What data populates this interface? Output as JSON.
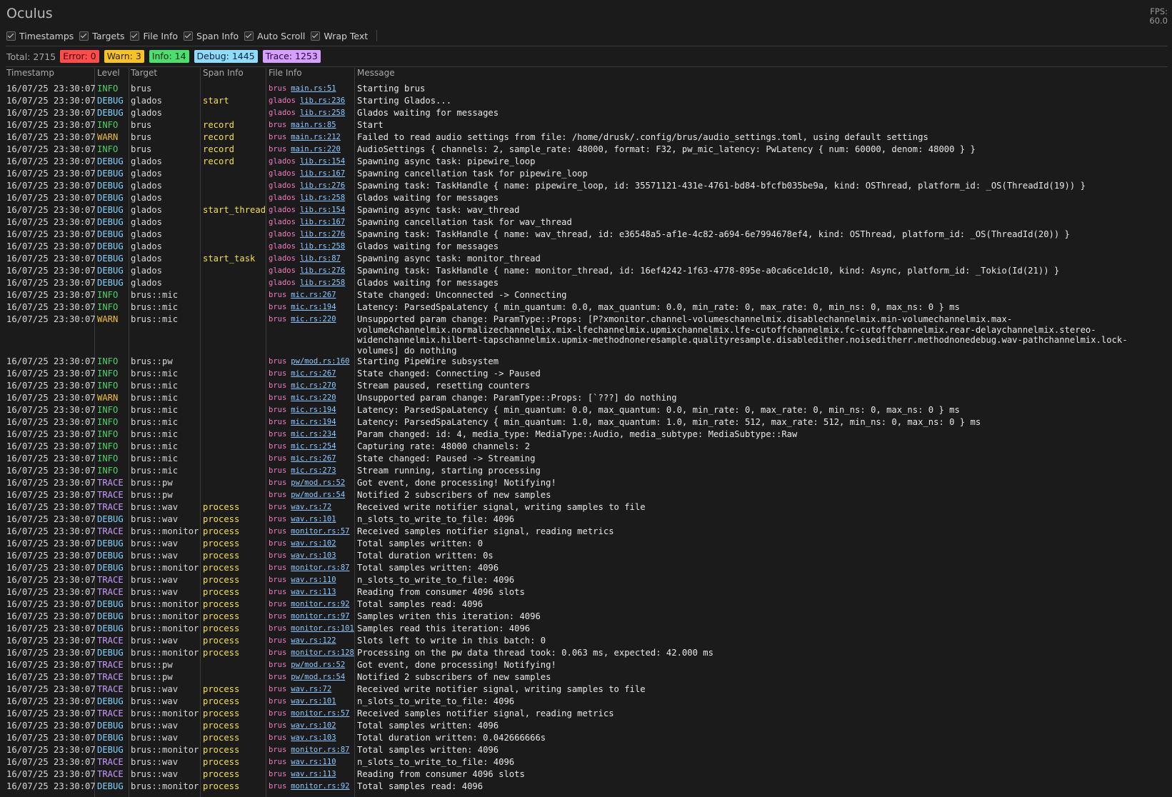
{
  "app": {
    "title": "Oculus",
    "fps_label": "FPS:",
    "fps_value": "60.0"
  },
  "toolbar": [
    {
      "label": "Timestamps",
      "checked": true
    },
    {
      "label": "Targets",
      "checked": true
    },
    {
      "label": "File Info",
      "checked": true
    },
    {
      "label": "Span Info",
      "checked": true
    },
    {
      "label": "Auto Scroll",
      "checked": true
    },
    {
      "label": "Wrap Text",
      "checked": true
    }
  ],
  "summary": {
    "total": "Total: 2715",
    "error": "Error: 0",
    "warn": "Warn: 3",
    "info": "Info: 14",
    "debug": "Debug: 1445",
    "trace": "Trace: 1253"
  },
  "columns": [
    "Timestamp",
    "Level",
    "Target",
    "Span Info",
    "File Info",
    "Message"
  ],
  "colors": {
    "error": "#ff4d4d",
    "warn": "#f7c325",
    "info": "#4cde6f",
    "debug": "#8fdcff",
    "trace": "#d5a0ff",
    "span": "#f1e04a",
    "crate": "#f07bbf",
    "file": "#8cc8ff"
  },
  "rows": [
    {
      "ts": "16/07/25 23:30:07",
      "level": "INFO",
      "target": "brus",
      "span": "",
      "crate": "brus",
      "file": "main.rs:51",
      "msg": "Starting brus"
    },
    {
      "ts": "16/07/25 23:30:07",
      "level": "DEBUG",
      "target": "glados",
      "span": "start",
      "crate": "glados",
      "file": "lib.rs:236",
      "msg": "Starting Glados..."
    },
    {
      "ts": "16/07/25 23:30:07",
      "level": "DEBUG",
      "target": "glados",
      "span": "",
      "crate": "glados",
      "file": "lib.rs:258",
      "msg": "Glados waiting for messages"
    },
    {
      "ts": "16/07/25 23:30:07",
      "level": "INFO",
      "target": "brus",
      "span": "record",
      "crate": "brus",
      "file": "main.rs:85",
      "msg": "Start"
    },
    {
      "ts": "16/07/25 23:30:07",
      "level": "WARN",
      "target": "brus",
      "span": "record",
      "crate": "brus",
      "file": "main.rs:212",
      "msg": "Failed to read audio settings from file: /home/drusk/.config/brus/audio_settings.toml, using default settings"
    },
    {
      "ts": "16/07/25 23:30:07",
      "level": "INFO",
      "target": "brus",
      "span": "record",
      "crate": "brus",
      "file": "main.rs:220",
      "msg": "AudioSettings { channels: 2, sample_rate: 48000, format: F32, pw_mic_latency: PwLatency { num: 60000, denom: 48000 } }"
    },
    {
      "ts": "16/07/25 23:30:07",
      "level": "DEBUG",
      "target": "glados",
      "span": "record",
      "crate": "glados",
      "file": "lib.rs:154",
      "msg": "Spawning async task: pipewire_loop"
    },
    {
      "ts": "16/07/25 23:30:07",
      "level": "DEBUG",
      "target": "glados",
      "span": "",
      "crate": "glados",
      "file": "lib.rs:167",
      "msg": "Spawning cancellation task for pipewire_loop"
    },
    {
      "ts": "16/07/25 23:30:07",
      "level": "DEBUG",
      "target": "glados",
      "span": "",
      "crate": "glados",
      "file": "lib.rs:276",
      "msg": "Spawning task: TaskHandle { name: pipewire_loop, id: 35571121-431e-4761-bd84-bfcfb035be9a, kind: OSThread, platform_id: _OS(ThreadId(19)) }"
    },
    {
      "ts": "16/07/25 23:30:07",
      "level": "DEBUG",
      "target": "glados",
      "span": "",
      "crate": "glados",
      "file": "lib.rs:258",
      "msg": "Glados waiting for messages"
    },
    {
      "ts": "16/07/25 23:30:07",
      "level": "DEBUG",
      "target": "glados",
      "span": "start_thread",
      "crate": "glados",
      "file": "lib.rs:154",
      "msg": "Spawning async task: wav_thread"
    },
    {
      "ts": "16/07/25 23:30:07",
      "level": "DEBUG",
      "target": "glados",
      "span": "",
      "crate": "glados",
      "file": "lib.rs:167",
      "msg": "Spawning cancellation task for wav_thread"
    },
    {
      "ts": "16/07/25 23:30:07",
      "level": "DEBUG",
      "target": "glados",
      "span": "",
      "crate": "glados",
      "file": "lib.rs:276",
      "msg": "Spawning task: TaskHandle { name: wav_thread, id: e36548a5-af1e-4c82-a694-6e7994678ef4, kind: OSThread, platform_id: _OS(ThreadId(20)) }"
    },
    {
      "ts": "16/07/25 23:30:07",
      "level": "DEBUG",
      "target": "glados",
      "span": "",
      "crate": "glados",
      "file": "lib.rs:258",
      "msg": "Glados waiting for messages"
    },
    {
      "ts": "16/07/25 23:30:07",
      "level": "DEBUG",
      "target": "glados",
      "span": "start_task",
      "crate": "glados",
      "file": "lib.rs:87",
      "msg": "Spawning async task: monitor_thread"
    },
    {
      "ts": "16/07/25 23:30:07",
      "level": "DEBUG",
      "target": "glados",
      "span": "",
      "crate": "glados",
      "file": "lib.rs:276",
      "msg": "Spawning task: TaskHandle { name: monitor_thread, id: 16ef4242-1f63-4778-895e-a0ca6ce1dc10, kind: Async, platform_id: _Tokio(Id(21)) }"
    },
    {
      "ts": "16/07/25 23:30:07",
      "level": "DEBUG",
      "target": "glados",
      "span": "",
      "crate": "glados",
      "file": "lib.rs:258",
      "msg": "Glados waiting for messages"
    },
    {
      "ts": "16/07/25 23:30:07",
      "level": "INFO",
      "target": "brus::mic",
      "span": "",
      "crate": "brus",
      "file": "mic.rs:267",
      "msg": "State changed: Unconnected -> Connecting"
    },
    {
      "ts": "16/07/25 23:30:07",
      "level": "INFO",
      "target": "brus::mic",
      "span": "",
      "crate": "brus",
      "file": "mic.rs:194",
      "msg": "Latency: ParsedSpaLatency { min_quantum: 0.0, max_quantum: 0.0, min_rate: 0, max_rate: 0, min_ns: 0, max_ns: 0 } ms"
    },
    {
      "ts": "16/07/25 23:30:07",
      "level": "WARN",
      "target": "brus::mic",
      "span": "",
      "crate": "brus",
      "file": "mic.rs:220",
      "tall": true,
      "msg": "Unsupported param change: ParamType::Props: [P?xmonitor.channel-volumeschannelmix.disablechannelmix.min-volumechannelmix.max-volumeAchannelmix.normalizechannelmix.mix-lfechannelmix.upmixchannelmix.lfe-cutoffchannelmix.fc-cutoffchannelmix.rear-delaychannelmix.stereo-widenchannelmix.hilbert-tapschannelmix.upmix-methodnoneresample.qualityresample.disabledither.noiseditherr.methodnonedebug.wav-pathchannelmix.lock-volumes] do nothing"
    },
    {
      "ts": "16/07/25 23:30:07",
      "level": "INFO",
      "target": "brus::pw",
      "span": "",
      "crate": "brus",
      "file": "pw/mod.rs:160",
      "msg": "Starting PipeWire subsystem"
    },
    {
      "ts": "16/07/25 23:30:07",
      "level": "INFO",
      "target": "brus::mic",
      "span": "",
      "crate": "brus",
      "file": "mic.rs:267",
      "msg": "State changed: Connecting -> Paused"
    },
    {
      "ts": "16/07/25 23:30:07",
      "level": "INFO",
      "target": "brus::mic",
      "span": "",
      "crate": "brus",
      "file": "mic.rs:270",
      "msg": "Stream paused, resetting counters"
    },
    {
      "ts": "16/07/25 23:30:07",
      "level": "WARN",
      "target": "brus::mic",
      "span": "",
      "crate": "brus",
      "file": "mic.rs:220",
      "msg": "Unsupported param change: ParamType::Props: [`???] do nothing"
    },
    {
      "ts": "16/07/25 23:30:07",
      "level": "INFO",
      "target": "brus::mic",
      "span": "",
      "crate": "brus",
      "file": "mic.rs:194",
      "msg": "Latency: ParsedSpaLatency { min_quantum: 0.0, max_quantum: 0.0, min_rate: 0, max_rate: 0, min_ns: 0, max_ns: 0 } ms"
    },
    {
      "ts": "16/07/25 23:30:07",
      "level": "INFO",
      "target": "brus::mic",
      "span": "",
      "crate": "brus",
      "file": "mic.rs:194",
      "msg": "Latency: ParsedSpaLatency { min_quantum: 1.0, max_quantum: 1.0, min_rate: 512, max_rate: 512, min_ns: 0, max_ns: 0 } ms"
    },
    {
      "ts": "16/07/25 23:30:07",
      "level": "INFO",
      "target": "brus::mic",
      "span": "",
      "crate": "brus",
      "file": "mic.rs:234",
      "msg": "Param changed: id: 4, media_type: MediaType::Audio, media_subtype: MediaSubtype::Raw"
    },
    {
      "ts": "16/07/25 23:30:07",
      "level": "INFO",
      "target": "brus::mic",
      "span": "",
      "crate": "brus",
      "file": "mic.rs:254",
      "msg": "Capturing rate: 48000 channels: 2"
    },
    {
      "ts": "16/07/25 23:30:07",
      "level": "INFO",
      "target": "brus::mic",
      "span": "",
      "crate": "brus",
      "file": "mic.rs:267",
      "msg": "State changed: Paused -> Streaming"
    },
    {
      "ts": "16/07/25 23:30:07",
      "level": "INFO",
      "target": "brus::mic",
      "span": "",
      "crate": "brus",
      "file": "mic.rs:273",
      "msg": "Stream running, starting processing"
    },
    {
      "ts": "16/07/25 23:30:07",
      "level": "TRACE",
      "target": "brus::pw",
      "span": "",
      "crate": "brus",
      "file": "pw/mod.rs:52",
      "msg": "Got event, done processing! Notifying!"
    },
    {
      "ts": "16/07/25 23:30:07",
      "level": "TRACE",
      "target": "brus::pw",
      "span": "",
      "crate": "brus",
      "file": "pw/mod.rs:54",
      "msg": "Notified 2 subscribers of new samples"
    },
    {
      "ts": "16/07/25 23:30:07",
      "level": "TRACE",
      "target": "brus::wav",
      "span": "process",
      "crate": "brus",
      "file": "wav.rs:72",
      "msg": "Received write notifier signal, writing samples to file"
    },
    {
      "ts": "16/07/25 23:30:07",
      "level": "DEBUG",
      "target": "brus::wav",
      "span": "process",
      "crate": "brus",
      "file": "wav.rs:101",
      "msg": "n_slots_to_write_to_file: 4096"
    },
    {
      "ts": "16/07/25 23:30:07",
      "level": "TRACE",
      "target": "brus::monitor",
      "span": "process",
      "crate": "brus",
      "file": "monitor.rs:57",
      "msg": "Received samples notifier signal, reading metrics"
    },
    {
      "ts": "16/07/25 23:30:07",
      "level": "DEBUG",
      "target": "brus::wav",
      "span": "process",
      "crate": "brus",
      "file": "wav.rs:102",
      "msg": "Total samples written: 0"
    },
    {
      "ts": "16/07/25 23:30:07",
      "level": "DEBUG",
      "target": "brus::wav",
      "span": "process",
      "crate": "brus",
      "file": "wav.rs:103",
      "msg": "Total duration written: 0s"
    },
    {
      "ts": "16/07/25 23:30:07",
      "level": "DEBUG",
      "target": "brus::monitor",
      "span": "process",
      "crate": "brus",
      "file": "monitor.rs:87",
      "msg": "Total samples written: 4096"
    },
    {
      "ts": "16/07/25 23:30:07",
      "level": "TRACE",
      "target": "brus::wav",
      "span": "process",
      "crate": "brus",
      "file": "wav.rs:110",
      "msg": "n_slots_to_write_to_file: 4096"
    },
    {
      "ts": "16/07/25 23:30:07",
      "level": "TRACE",
      "target": "brus::wav",
      "span": "process",
      "crate": "brus",
      "file": "wav.rs:113",
      "msg": "Reading from consumer 4096 slots"
    },
    {
      "ts": "16/07/25 23:30:07",
      "level": "DEBUG",
      "target": "brus::monitor",
      "span": "process",
      "crate": "brus",
      "file": "monitor.rs:92",
      "msg": "Total samples read: 4096"
    },
    {
      "ts": "16/07/25 23:30:07",
      "level": "DEBUG",
      "target": "brus::monitor",
      "span": "process",
      "crate": "brus",
      "file": "monitor.rs:97",
      "msg": "Samples writen this iteration: 4096"
    },
    {
      "ts": "16/07/25 23:30:07",
      "level": "DEBUG",
      "target": "brus::monitor",
      "span": "process",
      "crate": "brus",
      "file": "monitor.rs:101",
      "msg": "Samples read this iteration: 4096"
    },
    {
      "ts": "16/07/25 23:30:07",
      "level": "TRACE",
      "target": "brus::wav",
      "span": "process",
      "crate": "brus",
      "file": "wav.rs:122",
      "msg": "Slots left to write in this batch: 0"
    },
    {
      "ts": "16/07/25 23:30:07",
      "level": "DEBUG",
      "target": "brus::monitor",
      "span": "process",
      "crate": "brus",
      "file": "monitor.rs:128",
      "msg": "Processing on the pw data thread took: 0.063 ms, expected: 42.000 ms"
    },
    {
      "ts": "16/07/25 23:30:07",
      "level": "TRACE",
      "target": "brus::pw",
      "span": "",
      "crate": "brus",
      "file": "pw/mod.rs:52",
      "msg": "Got event, done processing! Notifying!"
    },
    {
      "ts": "16/07/25 23:30:07",
      "level": "TRACE",
      "target": "brus::pw",
      "span": "",
      "crate": "brus",
      "file": "pw/mod.rs:54",
      "msg": "Notified 2 subscribers of new samples"
    },
    {
      "ts": "16/07/25 23:30:07",
      "level": "TRACE",
      "target": "brus::wav",
      "span": "process",
      "crate": "brus",
      "file": "wav.rs:72",
      "msg": "Received write notifier signal, writing samples to file"
    },
    {
      "ts": "16/07/25 23:30:07",
      "level": "DEBUG",
      "target": "brus::wav",
      "span": "process",
      "crate": "brus",
      "file": "wav.rs:101",
      "msg": "n_slots_to_write_to_file: 4096"
    },
    {
      "ts": "16/07/25 23:30:07",
      "level": "TRACE",
      "target": "brus::monitor",
      "span": "process",
      "crate": "brus",
      "file": "monitor.rs:57",
      "msg": "Received samples notifier signal, reading metrics"
    },
    {
      "ts": "16/07/25 23:30:07",
      "level": "DEBUG",
      "target": "brus::wav",
      "span": "process",
      "crate": "brus",
      "file": "wav.rs:102",
      "msg": "Total samples written: 4096"
    },
    {
      "ts": "16/07/25 23:30:07",
      "level": "DEBUG",
      "target": "brus::wav",
      "span": "process",
      "crate": "brus",
      "file": "wav.rs:103",
      "msg": "Total duration written: 0.042666666s"
    },
    {
      "ts": "16/07/25 23:30:07",
      "level": "DEBUG",
      "target": "brus::monitor",
      "span": "process",
      "crate": "brus",
      "file": "monitor.rs:87",
      "msg": "Total samples written: 4096"
    },
    {
      "ts": "16/07/25 23:30:07",
      "level": "TRACE",
      "target": "brus::wav",
      "span": "process",
      "crate": "brus",
      "file": "wav.rs:110",
      "msg": "n_slots_to_write_to_file: 4096"
    },
    {
      "ts": "16/07/25 23:30:07",
      "level": "TRACE",
      "target": "brus::wav",
      "span": "process",
      "crate": "brus",
      "file": "wav.rs:113",
      "msg": "Reading from consumer 4096 slots"
    },
    {
      "ts": "16/07/25 23:30:07",
      "level": "DEBUG",
      "target": "brus::monitor",
      "span": "process",
      "crate": "brus",
      "file": "monitor.rs:92",
      "msg": "Total samples read: 4096"
    }
  ]
}
